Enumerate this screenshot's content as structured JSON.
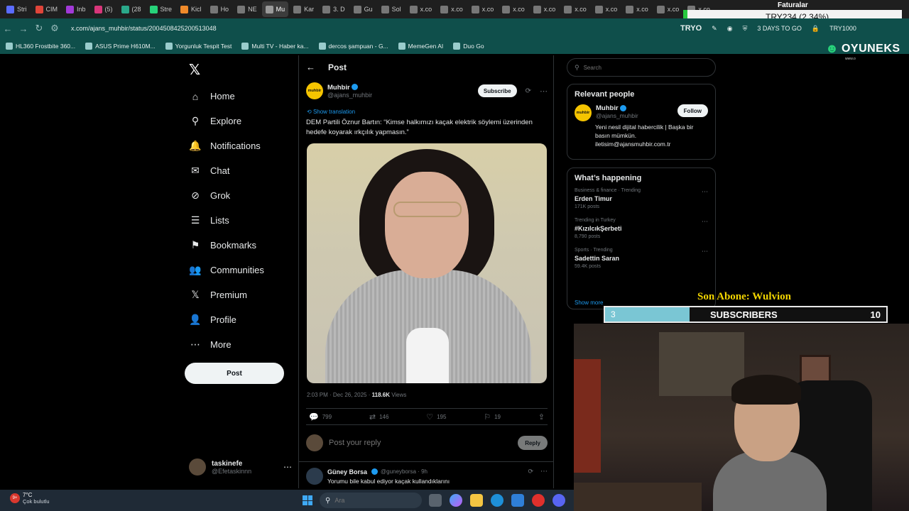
{
  "browser": {
    "tabs": [
      {
        "label": "Stri",
        "color": "#5b6cff"
      },
      {
        "label": "CIM",
        "color": "#e0453a"
      },
      {
        "label": "Inb",
        "color": "#a23ad8"
      },
      {
        "label": "(5)",
        "color": "#d8367a"
      },
      {
        "label": "(28",
        "color": "#2aa88a"
      },
      {
        "label": "Stre",
        "color": "#27d37a"
      },
      {
        "label": "Kicl",
        "color": "#f08a2a"
      },
      {
        "label": "Ho",
        "color": "#777777"
      },
      {
        "label": "NE",
        "color": "#777777"
      },
      {
        "label": "Mu",
        "color": "#9a9a9a",
        "active": true
      },
      {
        "label": "Kar",
        "color": "#777777"
      },
      {
        "label": "3. D",
        "color": "#777777"
      },
      {
        "label": "Gu",
        "color": "#777777"
      },
      {
        "label": "Sol",
        "color": "#777777"
      },
      {
        "label": "x.co",
        "color": "#777777"
      },
      {
        "label": "x.co",
        "color": "#777777"
      },
      {
        "label": "x.co",
        "color": "#777777"
      },
      {
        "label": "x.co",
        "color": "#777777"
      },
      {
        "label": "x.co",
        "color": "#777777"
      },
      {
        "label": "x.co",
        "color": "#777777"
      },
      {
        "label": "x.co",
        "color": "#777777"
      },
      {
        "label": "x.co",
        "color": "#777777"
      },
      {
        "label": "x.co",
        "color": "#777777"
      },
      {
        "label": "x.co",
        "color": "#777777"
      }
    ],
    "ticker": "TRY234 (2.34%)",
    "faturalar": "Faturalar",
    "url": "x.com/ajans_muhbir/status/2004508425200513048",
    "addr_right": {
      "tryo": "TRYO",
      "days": "3 DAYS TO GO",
      "try_right": "TRY1000"
    },
    "bookmarks": [
      "HL360 Frostbite 360...",
      "ASUS Prime H610M...",
      "Yorgunluk Tespit Test",
      "Multi TV - Haber ka...",
      "dercos şampuan - G...",
      "MemeGen AI",
      "Duo Go"
    ]
  },
  "nav": {
    "items": [
      {
        "key": "home",
        "label": "Home",
        "icon": "⌂"
      },
      {
        "key": "explore",
        "label": "Explore",
        "icon": "⚲"
      },
      {
        "key": "notifications",
        "label": "Notifications",
        "icon": "🔔"
      },
      {
        "key": "chat",
        "label": "Chat",
        "icon": "✉"
      },
      {
        "key": "grok",
        "label": "Grok",
        "icon": "⊘"
      },
      {
        "key": "lists",
        "label": "Lists",
        "icon": "☰"
      },
      {
        "key": "bookmarks",
        "label": "Bookmarks",
        "icon": "⚑"
      },
      {
        "key": "communities",
        "label": "Communities",
        "icon": "👥"
      },
      {
        "key": "premium",
        "label": "Premium",
        "icon": "𝕏"
      },
      {
        "key": "profile",
        "label": "Profile",
        "icon": "👤"
      },
      {
        "key": "more",
        "label": "More",
        "icon": "⋯"
      }
    ],
    "post_label": "Post",
    "account": {
      "name": "taskinefe",
      "handle": "@Efetaskinnn"
    }
  },
  "post": {
    "header_title": "Post",
    "author": {
      "name": "Muhbir",
      "handle": "@ajans_muhbir",
      "logo_text": "muhbir"
    },
    "subscribe_label": "Subscribe",
    "translate_label": "Show translation",
    "text": "DEM Partili Öznur Bartın: “Kimse halkımızı kaçak elektrik söylemi üzerinden hedefe koyarak ırkçılık yapmasın.”",
    "time": "2:03 PM · Dec 26, 2025 · ",
    "views_count": "118.6K",
    "views_label": " Views",
    "stats": {
      "replies": "799",
      "reposts": "146",
      "likes": "195",
      "bookmarks": "19"
    },
    "reply_placeholder": "Post your reply",
    "reply_label": "Reply"
  },
  "comment": {
    "name": "Güney Borsa",
    "handle": "@guneyborsa · 9h",
    "text": "Yorumu bile kabul ediyor kaçak kullandıklarını"
  },
  "right": {
    "search_placeholder": "Search",
    "relevant_title": "Relevant people",
    "relevant": {
      "name": "Muhbir",
      "handle": "@ajans_muhbir",
      "bio": "Yeni nesil dijital habercilik | Başka bir basın mümkün. iletisim@ajansmuhbir.com.tr",
      "follow_label": "Follow"
    },
    "happening_title": "What’s happening",
    "trends": [
      {
        "category": "Business & finance · Trending",
        "name": "Erden Timur",
        "count": "171K posts"
      },
      {
        "category": "Trending in Turkey",
        "name": "#KızılcıkŞerbeti",
        "count": "8,790 posts"
      },
      {
        "category": "Sports · Trending",
        "name": "Sadettin Saran",
        "count": "59.4K posts"
      }
    ],
    "show_more": "Show more"
  },
  "overlay": {
    "brand": "OYUNEKS",
    "brand_sub": "www.o",
    "son_abone": "Son Abone: Wulvion",
    "sub_current": "3",
    "sub_label": "SUBSCRIBERS",
    "sub_target": "10",
    "sub_progress": 0.3,
    "sub_fill_color": "#7ac6d4"
  },
  "taskbar": {
    "notif_count": "9+",
    "temp": "7°C",
    "weather": "Çok bulutlu",
    "search_placeholder": "Ara"
  }
}
